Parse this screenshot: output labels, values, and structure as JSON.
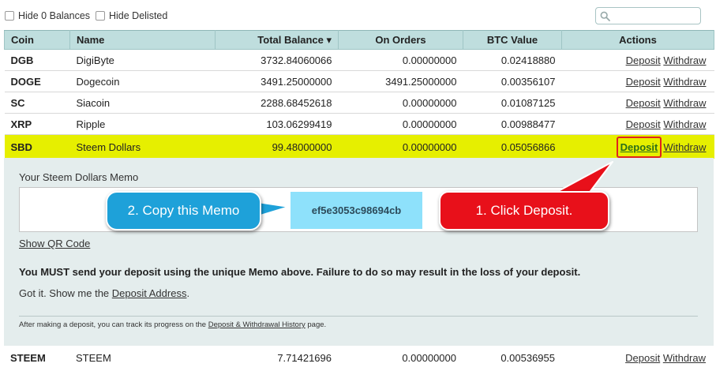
{
  "filters": {
    "hide_zero": "Hide 0 Balances",
    "hide_delisted": "Hide Delisted"
  },
  "search": {
    "placeholder": ""
  },
  "table": {
    "headers": {
      "coin": "Coin",
      "name": "Name",
      "total": "Total Balance",
      "orders": "On Orders",
      "btc": "BTC Value",
      "actions": "Actions"
    },
    "sort_indicator": "▾",
    "rows": [
      {
        "coin": "DGB",
        "name": "DigiByte",
        "total": "3732.84060066",
        "orders": "0.00000000",
        "btc": "0.02418880"
      },
      {
        "coin": "DOGE",
        "name": "Dogecoin",
        "total": "3491.25000000",
        "orders": "3491.25000000",
        "btc": "0.00356107"
      },
      {
        "coin": "SC",
        "name": "Siacoin",
        "total": "2288.68452618",
        "orders": "0.00000000",
        "btc": "0.01087125"
      },
      {
        "coin": "XRP",
        "name": "Ripple",
        "total": "103.06299419",
        "orders": "0.00000000",
        "btc": "0.00988477"
      },
      {
        "coin": "SBD",
        "name": "Steem Dollars",
        "total": "99.48000000",
        "orders": "0.00000000",
        "btc": "0.05056866"
      },
      {
        "coin": "STEEM",
        "name": "STEEM",
        "total": "7.71421696",
        "orders": "0.00000000",
        "btc": "0.00536955"
      }
    ],
    "deposit_label": "Deposit",
    "withdraw_label": "Withdraw"
  },
  "deposit_panel": {
    "memo_label": "Your Steem Dollars Memo",
    "memo_value": "ef5e3053c98694cb",
    "qr_link": "Show QR Code",
    "warning": "You MUST send your deposit using the unique Memo above. Failure to do so may result in the loss of your deposit.",
    "gotit_prefix": "Got it. Show me the ",
    "gotit_link": "Deposit Address",
    "gotit_suffix": ".",
    "track_prefix": "After making a deposit, you can track its progress on the ",
    "track_link": "Deposit & Withdrawal History",
    "track_suffix": " page."
  },
  "annotations": {
    "copy_memo": "2. Copy this Memo",
    "click_deposit": "1. Click Deposit.",
    "colors": {
      "highlight_row": "#e6ef00",
      "callout_blue": "#1ea1d9",
      "callout_red": "#e8101a",
      "memo_bg": "#8ee1fb"
    }
  }
}
